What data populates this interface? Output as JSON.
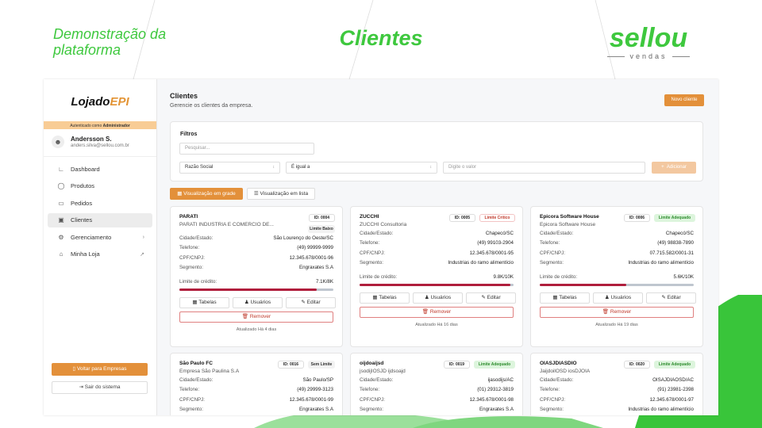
{
  "slide": {
    "title": "Demonstração da plataforma",
    "heading": "Clientes",
    "brand_name": "sellou",
    "brand_sub": "vendas"
  },
  "sidebar": {
    "logo_main": "Lojado",
    "logo_accent": "EPI",
    "auth_prefix": "Autenticado como ",
    "auth_role": "Administrador",
    "user": {
      "name": "Andersson S.",
      "email": "anders.silva@sellou.com.br"
    },
    "items": [
      {
        "label": "Dashboard",
        "icon": "chart-icon"
      },
      {
        "label": "Produtos",
        "icon": "box-icon"
      },
      {
        "label": "Pedidos",
        "icon": "clipboard-icon"
      },
      {
        "label": "Clientes",
        "icon": "contacts-icon"
      },
      {
        "label": "Gerenciamento",
        "icon": "gear-icon"
      },
      {
        "label": "Minha Loja",
        "icon": "store-icon"
      }
    ],
    "btn_empresas": "Voltar para Empresas",
    "btn_sair": "Sair do sistema"
  },
  "main": {
    "title": "Clientes",
    "subtitle": "Gerencie os clientes da empresa.",
    "new_button": "Novo cliente",
    "filters": {
      "title": "Filtros",
      "search_placeholder": "Pesquisar...",
      "field": "Razão Social",
      "operator": "É igual a",
      "value_placeholder": "Digite o valor",
      "add_label": "Adicionar"
    },
    "view_grid": "Visualização em grade",
    "view_list": "Visualização em lista"
  },
  "labels": {
    "city": "Cidade/Estado:",
    "phone": "Telefone:",
    "cnpj": "CPF/CNPJ:",
    "segment": "Segmento:",
    "credit": "Limite de crédito:",
    "tables": "Tabelas",
    "users": "Usuários",
    "edit": "Editar",
    "remove": "Remover"
  },
  "clients": [
    {
      "name": "PARATI",
      "company": "PARATI INDUSTRIA E COMERCIO DE...",
      "id": "ID: 0004",
      "status": "Limite Baixo",
      "city": "São Lourenço do Oeste/SC",
      "phone": "(49) 99999-9999",
      "cnpj": "12.345.678/0001-96",
      "segment": "Engraxates S.A",
      "credit": "7.1K/8K",
      "credit_ratio": 0.89,
      "updated": "Atualizado Há 4 dias"
    },
    {
      "name": "ZUCCHI",
      "company": "ZUCCHI Consultoria",
      "id": "ID: 0005",
      "status": "Limite Crítico",
      "city": "Chapecó/SC",
      "phone": "(49) 99103-2904",
      "cnpj": "12.345.678/0001-95",
      "segment": "Industrias do ramo alimentício",
      "credit": "9.8K/10K",
      "credit_ratio": 0.98,
      "updated": "Atualizado Há 16 dias"
    },
    {
      "name": "Epicora Software House",
      "company": "Epicora Software House",
      "id": "ID: 0006",
      "status": "Limite Adequado",
      "city": "Chapecó/SC",
      "phone": "(49) 98838-7890",
      "cnpj": "07.715.582/0001-31",
      "segment": "Industrias do ramo alimentício",
      "credit": "5.6K/10K",
      "credit_ratio": 0.56,
      "updated": "Atualizado Há 19 dias"
    },
    {
      "name": "São Paulo FC",
      "company": "Empresa São Paulina S.A",
      "id": "ID: 0016",
      "status": "Sem Limite",
      "city": "São Paulo/SP",
      "phone": "(49) 29999-3123",
      "cnpj": "12.345.678/0001-99",
      "segment": "Engraxates S.A"
    },
    {
      "name": "oijdoaijsd",
      "company": "jsodijIOSJD ijdsoajd",
      "id": "ID: 0019",
      "status": "Limite Adequado",
      "city": "ijasodijs/AC",
      "phone": "(01) 29312-3819",
      "cnpj": "12.345.678/0001-98",
      "segment": "Engraxates S.A"
    },
    {
      "name": "OIASJDIASDIO",
      "company": "JaijdoilOSD iosDJOIA",
      "id": "ID: 0020",
      "status": "Limite Adequado",
      "city": "OISAJDIAOSD/AC",
      "phone": "(91) 23981-2398",
      "cnpj": "12.345.678/0001-97",
      "segment": "Industrias do ramo alimentício"
    }
  ],
  "colors": {
    "green": "#3ec83e",
    "orange": "#e3903a",
    "red": "#b01e3c"
  }
}
